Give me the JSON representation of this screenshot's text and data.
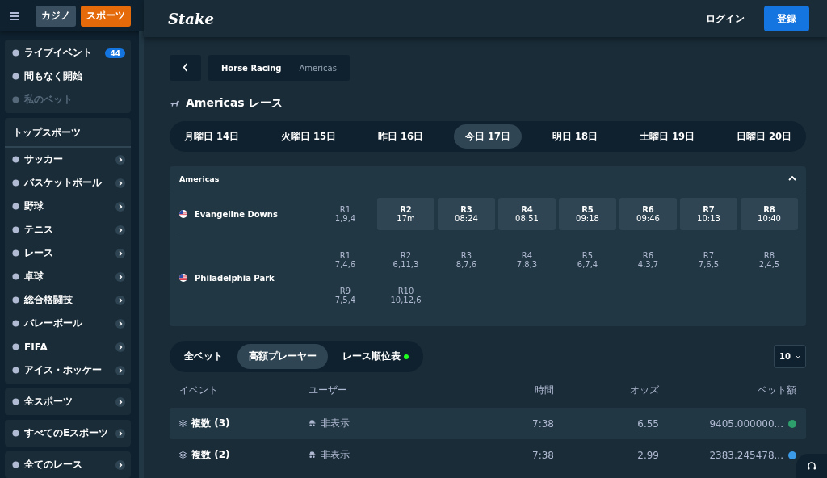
{
  "top_nav": {
    "tabs": [
      {
        "label": "カジノ",
        "selected": false
      },
      {
        "label": "スポーツ",
        "selected": true
      }
    ]
  },
  "header": {
    "logo": "Stake",
    "login": "ログイン",
    "register": "登録"
  },
  "sidebar": {
    "groups": [
      {
        "items": [
          {
            "label": "ライブイベント",
            "badge": "44",
            "disabled": false
          },
          {
            "label": "間もなく開始",
            "disabled": false
          },
          {
            "label": "私のベット",
            "disabled": true
          }
        ]
      },
      {
        "title": "トップスポーツ",
        "items": [
          {
            "label": "サッカー"
          },
          {
            "label": "バスケットボール"
          },
          {
            "label": "野球"
          },
          {
            "label": "テニス"
          },
          {
            "label": "レース"
          },
          {
            "label": "卓球"
          },
          {
            "label": "総合格闘技"
          },
          {
            "label": "バレーボール"
          },
          {
            "label": "FIFA"
          },
          {
            "label": "アイス・ホッケー"
          }
        ]
      },
      {
        "items": [
          {
            "label": "全スポーツ"
          }
        ]
      },
      {
        "items": [
          {
            "label": "すべてのEスポーツ"
          }
        ]
      },
      {
        "items": [
          {
            "label": "全てのレース"
          }
        ]
      }
    ]
  },
  "breadcrumb": [
    {
      "label": "Horse Racing",
      "selected": false
    },
    {
      "label": "Americas",
      "selected": true
    }
  ],
  "page_title": "Americas レース",
  "day_tabs": [
    {
      "label": "月曜日 14日",
      "selected": false
    },
    {
      "label": "火曜日 15日",
      "selected": false
    },
    {
      "label": "昨日 16日",
      "selected": false
    },
    {
      "label": "今日 17日",
      "selected": true
    },
    {
      "label": "明日 18日",
      "selected": false
    },
    {
      "label": "土曜日 19日",
      "selected": false
    },
    {
      "label": "日曜日 20日",
      "selected": false
    }
  ],
  "region": {
    "title": "Americas",
    "expanded": true,
    "tracks": [
      {
        "name": "Evangeline Downs",
        "races": [
          {
            "race": "R1",
            "info": "1,9,4",
            "upcoming": false
          },
          {
            "race": "R2",
            "info": "17m",
            "upcoming": true
          },
          {
            "race": "R3",
            "info": "08:24",
            "upcoming": true
          },
          {
            "race": "R4",
            "info": "08:51",
            "upcoming": true
          },
          {
            "race": "R5",
            "info": "09:18",
            "upcoming": true
          },
          {
            "race": "R6",
            "info": "09:46",
            "upcoming": true
          },
          {
            "race": "R7",
            "info": "10:13",
            "upcoming": true
          },
          {
            "race": "R8",
            "info": "10:40",
            "upcoming": true
          }
        ]
      },
      {
        "name": "Philadelphia Park",
        "races": [
          {
            "race": "R1",
            "info": "7,4,6",
            "upcoming": false
          },
          {
            "race": "R2",
            "info": "6,11,3",
            "upcoming": false
          },
          {
            "race": "R3",
            "info": "8,7,6",
            "upcoming": false
          },
          {
            "race": "R4",
            "info": "7,8,3",
            "upcoming": false
          },
          {
            "race": "R5",
            "info": "6,7,4",
            "upcoming": false
          },
          {
            "race": "R6",
            "info": "4,3,7",
            "upcoming": false
          },
          {
            "race": "R7",
            "info": "7,6,5",
            "upcoming": false
          },
          {
            "race": "R8",
            "info": "2,4,5",
            "upcoming": false
          },
          {
            "race": "R9",
            "info": "7,5,4",
            "upcoming": false
          },
          {
            "race": "R10",
            "info": "10,12,6",
            "upcoming": false
          }
        ]
      }
    ]
  },
  "bet_tabs": [
    {
      "label": "全ベット",
      "selected": false,
      "live": false
    },
    {
      "label": "高額プレーヤー",
      "selected": true,
      "live": false
    },
    {
      "label": "レース順位表",
      "selected": false,
      "live": true
    }
  ],
  "page_size": "10",
  "table": {
    "columns": [
      "イベント",
      "ユーザー",
      "時間",
      "オッズ",
      "ベット額"
    ],
    "rows": [
      {
        "event": "複数 (3)",
        "user": "非表示",
        "time": "7:38",
        "odds": "6.55",
        "amount": "9405.000000...",
        "color": "#2e9e6c"
      },
      {
        "event": "複数 (2)",
        "user": "非表示",
        "time": "7:38",
        "odds": "2.99",
        "amount": "2383.245478...",
        "color": "#3b9be8"
      }
    ]
  }
}
